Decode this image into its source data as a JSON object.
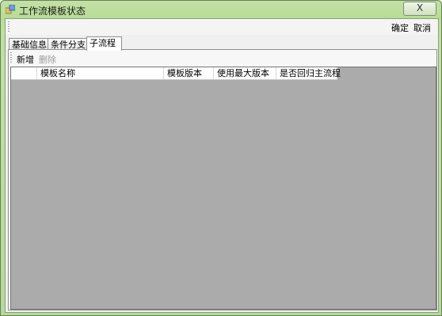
{
  "window": {
    "title": "工作流模板状态",
    "close_symbol": "X"
  },
  "toolbar": {
    "ok_label": "确定",
    "cancel_label": "取消"
  },
  "tabs": [
    {
      "label": "基础信息"
    },
    {
      "label": "条件分支"
    },
    {
      "label": "子流程"
    }
  ],
  "sub_toolbar": {
    "add_label": "新增",
    "delete_label": "删除"
  },
  "grid": {
    "columns": [
      {
        "label": ""
      },
      {
        "label": "模板名称"
      },
      {
        "label": "模板版本"
      },
      {
        "label": "使用最大版本"
      },
      {
        "label": "是否回归主流程"
      }
    ]
  },
  "colors": {
    "frame": "#b8dc96",
    "grid_background": "#ababab"
  }
}
